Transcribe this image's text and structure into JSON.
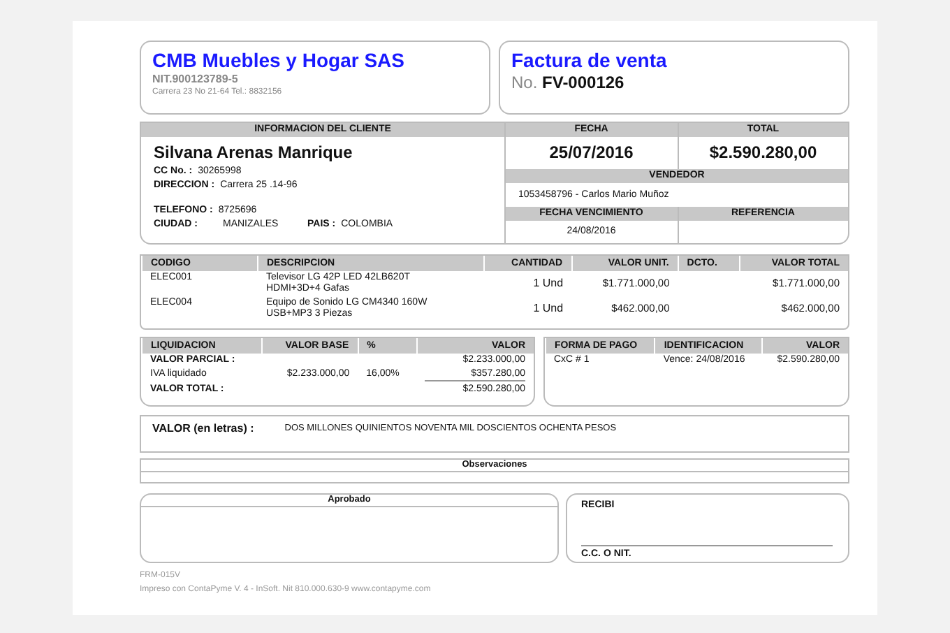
{
  "company": {
    "name": "CMB Muebles y Hogar SAS",
    "nit": "NIT.900123789-5",
    "address": "Carrera 23 No 21-64  Tel.: 8832156"
  },
  "invoice": {
    "title": "Factura de venta",
    "number_label": "No.",
    "number": "FV-000126"
  },
  "client": {
    "heading": "INFORMACION DEL CLIENTE",
    "name": "Silvana Arenas Manrique",
    "rows": [
      [
        {
          "label": "CC  No. :",
          "value": "30265998"
        }
      ],
      [
        {
          "label": "DIRECCION :",
          "value": "Carrera 25 .14-96"
        }
      ],
      [
        {
          "label": "TELEFONO :",
          "value": "8725696"
        }
      ],
      [
        {
          "label": "CIUDAD :",
          "value": "MANIZALES"
        },
        {
          "label": "PAIS :",
          "value": "COLOMBIA"
        }
      ]
    ]
  },
  "summary": {
    "date_heading": "FECHA",
    "date": "25/07/2016",
    "total_heading": "TOTAL",
    "total": "$2.590.280,00",
    "seller_heading": "VENDEDOR",
    "seller": "1053458796 - Carlos Mario Muñoz",
    "due_heading": "FECHA VENCIMIENTO",
    "due_date": "24/08/2016",
    "reference_heading": "REFERENCIA"
  },
  "items": {
    "columns": [
      "CODIGO",
      "DESCRIPCION",
      "CANTIDAD",
      "VALOR UNIT.",
      "DCTO.",
      "VALOR TOTAL"
    ],
    "rows": [
      {
        "code": "ELEC001",
        "description": [
          "Televisor  LG 42P LED 42LB620T",
          "HDMI+3D+4 Gafas"
        ],
        "quantity": "1 Und",
        "unit_value": "$1.771.000,00",
        "total": "$1.771.000,00"
      },
      {
        "code": "ELEC004",
        "description": [
          "Equipo de Sonido LG CM4340 160W",
          "USB+MP3 3 Piezas"
        ],
        "quantity": "1 Und",
        "unit_value": "$462.000,00",
        "total": "$462.000,00"
      }
    ]
  },
  "settlement": {
    "columns": [
      "LIQUIDACION",
      "VALOR BASE",
      "%",
      "VALOR"
    ],
    "rows": [
      {
        "kind": "subtotal",
        "label": "VALOR PARCIAL :",
        "value": "$2.233.000,00"
      },
      {
        "kind": "tax",
        "label": "IVA liquidado",
        "base": "$2.233.000,00",
        "percent": "16,00%",
        "value": "$357.280,00"
      },
      {
        "kind": "total",
        "label": "VALOR TOTAL :",
        "value": "$2.590.280,00"
      }
    ]
  },
  "payment": {
    "columns": [
      "FORMA DE PAGO",
      "IDENTIFICACION",
      "VALOR"
    ],
    "rows": [
      {
        "method": "CxC # 1",
        "identification": "Vence: 24/08/2016",
        "value": "$2.590.280,00"
      }
    ]
  },
  "amount_in_words": {
    "label": "VALOR (en letras) :",
    "value": "DOS MILLONES QUINIENTOS NOVENTA MIL DOSCIENTOS OCHENTA PESOS"
  },
  "observations": {
    "heading": "Observaciones"
  },
  "approval": {
    "heading": "Aprobado"
  },
  "receipt": {
    "label": "RECIBI",
    "id_label": "C.C. O NIT."
  },
  "footer": {
    "form_code": "FRM-015V",
    "printed_by": "Impreso con ContaPyme V. 4 - InSoft. Nit 810.000.630-9 www.contapyme.com"
  }
}
